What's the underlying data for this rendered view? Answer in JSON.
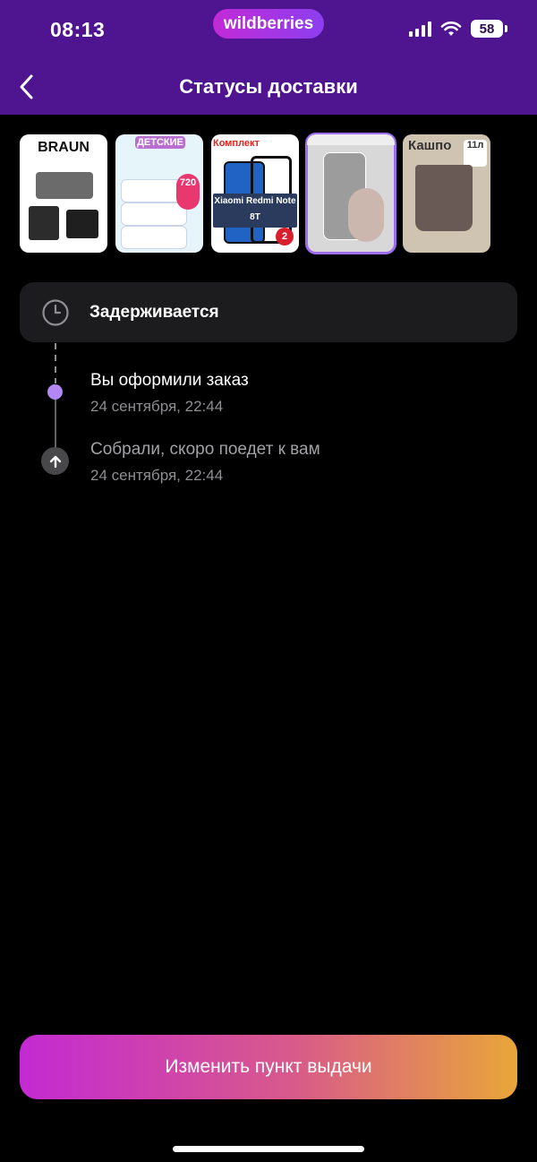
{
  "status_bar": {
    "time": "08:13",
    "brand": "wildberries",
    "battery": "58"
  },
  "header": {
    "title": "Статусы доставки"
  },
  "products": [
    {
      "name": "braun-grill",
      "label": "BRAUN"
    },
    {
      "name": "baby-wipes",
      "label": "ДЕТСКИЕ",
      "badge": "720"
    },
    {
      "name": "phone-glass",
      "label": "Комплект",
      "caption": "Xiaomi Redmi Note 8T",
      "count": "2"
    },
    {
      "name": "phone-case",
      "selected": true
    },
    {
      "name": "flower-pot",
      "label": "Кашпо",
      "volume": "11л"
    }
  ],
  "current_status": {
    "label": "Задерживается"
  },
  "timeline": [
    {
      "title": "Вы оформили заказ",
      "date": "24 сентября, 22:44"
    },
    {
      "title": "Собрали, скоро поедет к вам",
      "date": "24 сентября, 22:44"
    }
  ],
  "actions": {
    "change_pickup": "Изменить пункт выдачи"
  },
  "colors": {
    "header_bg": "#4f148f",
    "accent_purple": "#b187f4",
    "button_start": "#c42ad2",
    "button_end": "#e8a638"
  }
}
